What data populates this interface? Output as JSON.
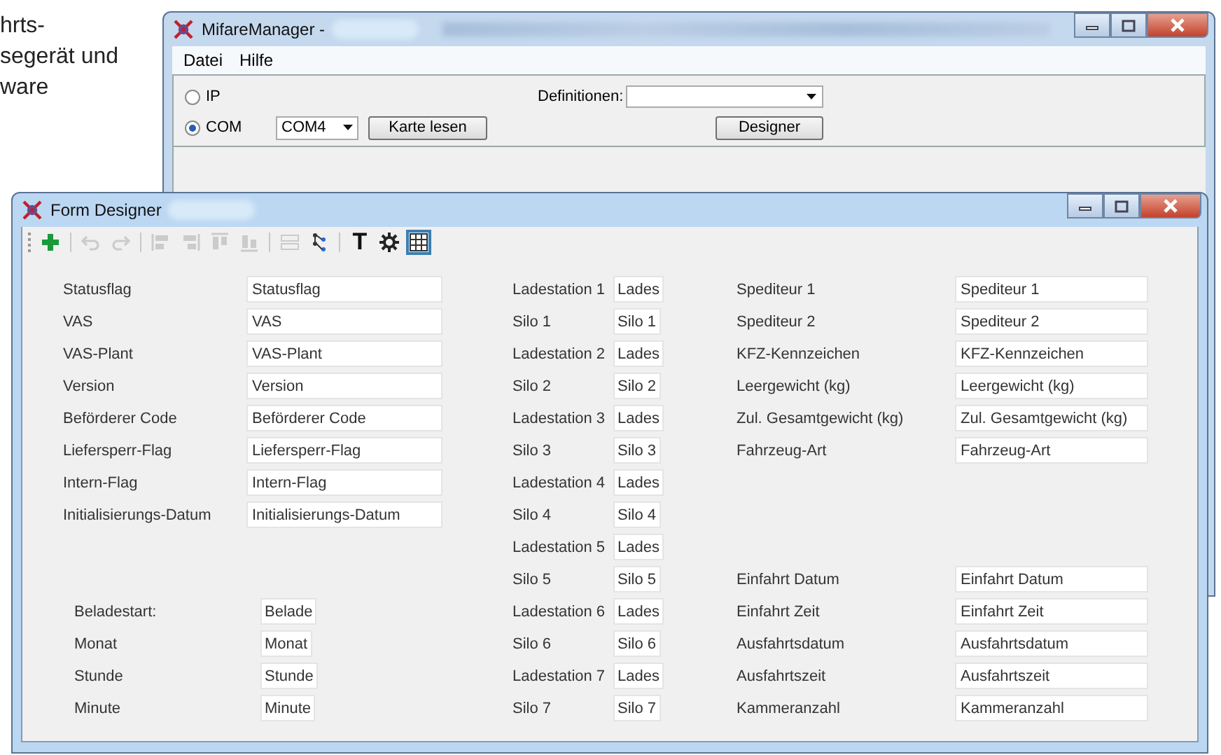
{
  "background_page": {
    "lines": [
      "hrts-",
      "segerät und",
      "ware"
    ]
  },
  "main_window": {
    "title": "MifareManager -",
    "menu": [
      "Datei",
      "Hilfe"
    ],
    "connection": [
      {
        "label": "IP",
        "selected": false
      },
      {
        "label": "COM",
        "selected": true
      }
    ],
    "port": {
      "value": "COM4"
    },
    "read_button": "Karte lesen",
    "definitions": {
      "label": "Definitionen:"
    },
    "designer_button": "Designer"
  },
  "designer_window": {
    "title": "Form Designer",
    "toolbar": [
      {
        "kind": "add",
        "disabled": false,
        "selected": false
      },
      {
        "kind": "separator"
      },
      {
        "kind": "undo",
        "disabled": true,
        "selected": false
      },
      {
        "kind": "redo",
        "disabled": true,
        "selected": false
      },
      {
        "kind": "separator"
      },
      {
        "kind": "align-left",
        "disabled": true,
        "selected": false
      },
      {
        "kind": "align-right",
        "disabled": true,
        "selected": false
      },
      {
        "kind": "align-top",
        "disabled": true,
        "selected": false
      },
      {
        "kind": "align-bottom",
        "disabled": true,
        "selected": false
      },
      {
        "kind": "separator"
      },
      {
        "kind": "same-size",
        "disabled": true,
        "selected": false
      },
      {
        "kind": "hierarchy",
        "disabled": false,
        "selected": false
      },
      {
        "kind": "separator"
      },
      {
        "kind": "text",
        "label": "T",
        "disabled": false,
        "selected": false
      },
      {
        "kind": "settings",
        "disabled": false,
        "selected": false
      },
      {
        "kind": "grid",
        "disabled": false,
        "selected": true
      }
    ],
    "columns": [
      {
        "groups": [
          {
            "rows": [
              {
                "label": "Statusflag",
                "value": "Statusflag"
              },
              {
                "label": "VAS",
                "value": "VAS"
              },
              {
                "label": "VAS-Plant",
                "value": "VAS-Plant"
              },
              {
                "label": "Version",
                "value": "Version"
              },
              {
                "label": "Beförderer Code",
                "value": "Beförderer Code"
              },
              {
                "label": "Liefersperr-Flag",
                "value": "Liefersperr-Flag"
              },
              {
                "label": "Intern-Flag",
                "value": "Intern-Flag"
              },
              {
                "label": "Initialisierungs-Datum",
                "value": "Initialisierungs-Datum"
              }
            ]
          },
          {
            "rows": [
              {
                "label": "Beladestart:",
                "value": "Belade"
              },
              {
                "label": "Monat",
                "value": "Monat"
              },
              {
                "label": "Stunde",
                "value": "Stunde"
              },
              {
                "label": "Minute",
                "value": "Minute"
              }
            ]
          }
        ]
      },
      {
        "groups": [
          {
            "rows": [
              {
                "label": "Ladestation 1",
                "value": "Lades"
              },
              {
                "label": "Silo 1",
                "value": "Silo 1"
              },
              {
                "label": "Ladestation 2",
                "value": "Lades"
              },
              {
                "label": "Silo 2",
                "value": "Silo 2"
              },
              {
                "label": "Ladestation 3",
                "value": "Lades"
              },
              {
                "label": "Silo 3",
                "value": "Silo 3"
              },
              {
                "label": "Ladestation 4",
                "value": "Lades"
              },
              {
                "label": "Silo 4",
                "value": "Silo 4"
              },
              {
                "label": "Ladestation 5",
                "value": "Lades"
              },
              {
                "label": "Silo 5",
                "value": "Silo 5"
              },
              {
                "label": "Ladestation 6",
                "value": "Lades"
              },
              {
                "label": "Silo 6",
                "value": "Silo 6"
              },
              {
                "label": "Ladestation 7",
                "value": "Lades"
              },
              {
                "label": "Silo 7",
                "value": "Silo 7"
              }
            ]
          }
        ]
      },
      {
        "groups": [
          {
            "rows": [
              {
                "label": "Spediteur 1",
                "value": "Spediteur 1"
              },
              {
                "label": "Spediteur 2",
                "value": "Spediteur 2"
              },
              {
                "label": "KFZ-Kennzeichen",
                "value": "KFZ-Kennzeichen"
              },
              {
                "label": "Leergewicht (kg)",
                "value": "Leergewicht (kg)"
              },
              {
                "label": "Zul. Gesamtgewicht (kg)",
                "value": "Zul. Gesamtgewicht (kg)"
              },
              {
                "label": "Fahrzeug-Art",
                "value": "Fahrzeug-Art"
              }
            ]
          },
          {
            "rows": [
              {
                "label": "Einfahrt Datum",
                "value": "Einfahrt Datum"
              },
              {
                "label": "Einfahrt Zeit",
                "value": "Einfahrt Zeit"
              },
              {
                "label": "Ausfahrtsdatum",
                "value": "Ausfahrtsdatum"
              },
              {
                "label": "Ausfahrtszeit",
                "value": "Ausfahrtszeit"
              },
              {
                "label": "Kammeranzahl",
                "value": "Kammeranzahl"
              }
            ]
          }
        ]
      }
    ]
  }
}
